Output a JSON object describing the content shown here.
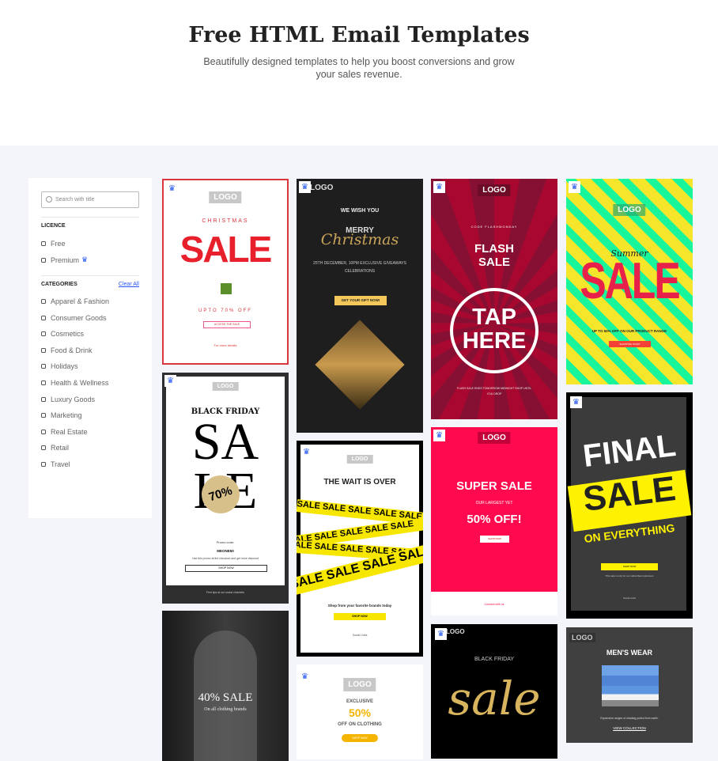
{
  "header": {
    "title": "Free HTML Email Templates",
    "subtitle": "Beautifully designed templates to help you boost conversions and grow your sales revenue."
  },
  "sidebar": {
    "search_placeholder": "Search with title",
    "licence_heading": "LICENCE",
    "licence": [
      "Free",
      "Premium"
    ],
    "categories_heading": "CATEGORIES",
    "clear_all": "Clear All",
    "categories": [
      "Apparel & Fashion",
      "Consumer Goods",
      "Cosmetics",
      "Food & Drink",
      "Holidays",
      "Health & Wellness",
      "Luxury Goods",
      "Marketing",
      "Real Estate",
      "Retail",
      "Travel"
    ]
  },
  "icons": {
    "premium": "crown-icon",
    "search": "search-icon"
  },
  "colors": {
    "accent": "#2354f0",
    "selected_border": "#d9363e"
  },
  "templates": {
    "xmas_sale": {
      "logo": "LOGO",
      "l1": "CHRISTMAS",
      "l2": "SALE",
      "l3": "UPTO 70% OFF",
      "btn": "ACCESS THE SALE",
      "foot": "For more details"
    },
    "merry": {
      "logo": "LOGO",
      "l1": "WE WISH YOU",
      "l2": "MERRY",
      "l3": "Christmas",
      "l4": "25TH DECEMBER, 10PM EXCLUSIVE GIVEAWAYS CELEBRATIONS",
      "btn": "GET YOUR GIFT NOW!"
    },
    "flash": {
      "logo": "LOGO",
      "l1": "CODE FLASHMONDAY",
      "l2": "FLASH SALE",
      "l3": "TAP HERE",
      "l4": "FLASH SALE ENDS TOMORROW MIDNIGHT SHOP UNTIL YOU DROP"
    },
    "summer": {
      "logo": "LOGO",
      "l1": "Summer",
      "l2": "SALE",
      "l3": "UP TO 50% OFF ON OUR PRODUCT RANGE",
      "btn": "SHOPPING START"
    },
    "bf": {
      "logo": "LOGO",
      "l1": "BLACK FRIDAY",
      "l2": "SA",
      "l3": "LE",
      "tag": "70%",
      "l4": "Promo code:",
      "l5": "MEONE50",
      "l6": "Use this promo at the checkout and get more discount",
      "btn": "SHOP NOW",
      "foot": "Find tips at our social channels"
    },
    "wait": {
      "logo": "LOGO",
      "l1": "THE WAIT IS OVER",
      "tape": "SALE SALE SALE SALE SALE",
      "l2": "Shop from your favorite brands today",
      "btn": "SHOP NOW",
      "foot": "Social Links"
    },
    "super": {
      "logo": "LOGO",
      "l1": "SUPER SALE",
      "l2": "OUR LARGEST YET",
      "l3": "50% OFF!",
      "btn": "SHOP NOW",
      "foot": "Connect with us"
    },
    "final": {
      "logo": "LOGO",
      "l1": "FINAL",
      "l2": "SALE",
      "l3": "ON EVERYTHING",
      "btn": "SHOP NOW",
      "l4": "This sale is only for our subscribed customers",
      "foot": "Social Links"
    },
    "fashion": {
      "l1": "40% SALE",
      "l2": "On all clothing brands"
    },
    "exclusive": {
      "logo": "LOGO",
      "l1": "EXCLUSIVE",
      "l2": "50%",
      "l3": "OFF ON CLOTHING",
      "btn": "SHOP NOW"
    },
    "bfsale": {
      "logo": "LOGO",
      "l1": "BLACK FRIDAY",
      "l2": "sale"
    },
    "mens": {
      "logo": "LOGO",
      "l1": "MEN'S WEAR",
      "l2": "Expensive ranges of shading pulled from earth.",
      "btn": "VIEW COLLECTION"
    }
  }
}
